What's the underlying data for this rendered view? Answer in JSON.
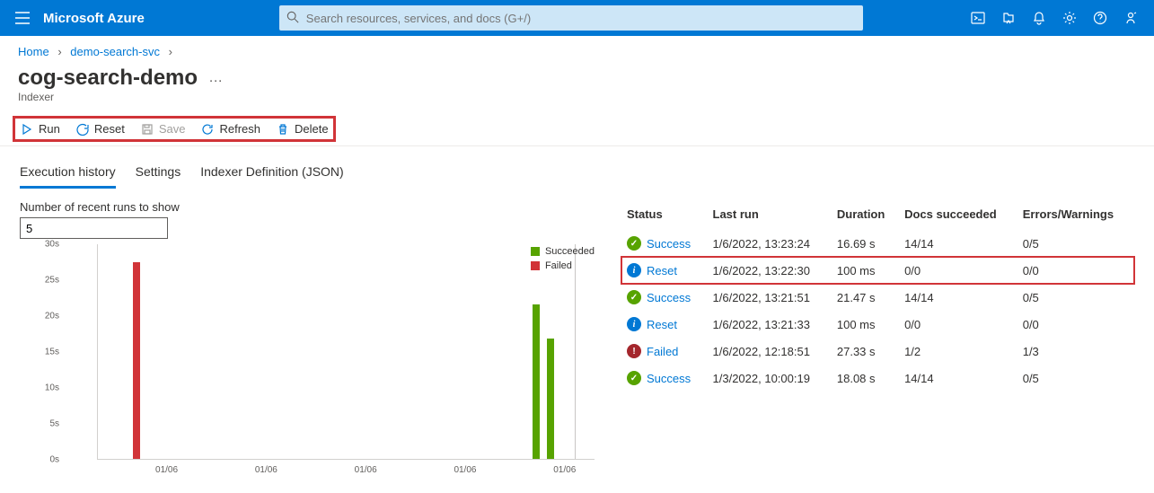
{
  "brand": "Microsoft Azure",
  "search": {
    "placeholder": "Search resources, services, and docs (G+/)"
  },
  "breadcrumb": {
    "home": "Home",
    "parent": "demo-search-svc"
  },
  "page": {
    "title": "cog-search-demo",
    "subtitle": "Indexer"
  },
  "toolbar": {
    "run": "Run",
    "reset": "Reset",
    "save": "Save",
    "refresh": "Refresh",
    "delete": "Delete"
  },
  "tabs": {
    "t0": "Execution history",
    "t1": "Settings",
    "t2": "Indexer Definition (JSON)"
  },
  "field": {
    "label": "Number of recent runs to show",
    "value": "5"
  },
  "legend": {
    "succeeded": "Succeeded",
    "failed": "Failed"
  },
  "chart_data": {
    "type": "bar",
    "ylabel": "",
    "ylim": [
      0,
      30
    ],
    "y_ticks": [
      "0s",
      "5s",
      "10s",
      "15s",
      "20s",
      "25s",
      "30s"
    ],
    "x_ticks": [
      "01/06",
      "01/06",
      "01/06",
      "01/06",
      "01/06"
    ],
    "series": [
      {
        "name": "Failed",
        "values": [
          27.33
        ],
        "color": "#d13438",
        "positions": [
          0.07
        ]
      },
      {
        "name": "Succeeded",
        "values": [
          21.47,
          16.69
        ],
        "color": "#57a300",
        "positions": [
          0.875,
          0.905
        ]
      }
    ]
  },
  "table": {
    "headers": {
      "status": "Status",
      "last_run": "Last run",
      "duration": "Duration",
      "docs": "Docs succeeded",
      "errs": "Errors/Warnings"
    },
    "rows": [
      {
        "status": "Success",
        "icon": "success",
        "last_run": "1/6/2022, 13:23:24",
        "duration": "16.69 s",
        "docs": "14/14",
        "errs": "0/5"
      },
      {
        "status": "Reset",
        "icon": "info",
        "last_run": "1/6/2022, 13:22:30",
        "duration": "100 ms",
        "docs": "0/0",
        "errs": "0/0",
        "highlight": true
      },
      {
        "status": "Success",
        "icon": "success",
        "last_run": "1/6/2022, 13:21:51",
        "duration": "21.47 s",
        "docs": "14/14",
        "errs": "0/5"
      },
      {
        "status": "Reset",
        "icon": "info",
        "last_run": "1/6/2022, 13:21:33",
        "duration": "100 ms",
        "docs": "0/0",
        "errs": "0/0"
      },
      {
        "status": "Failed",
        "icon": "fail",
        "last_run": "1/6/2022, 12:18:51",
        "duration": "27.33 s",
        "docs": "1/2",
        "errs": "1/3"
      },
      {
        "status": "Success",
        "icon": "success",
        "last_run": "1/3/2022, 10:00:19",
        "duration": "18.08 s",
        "docs": "14/14",
        "errs": "0/5"
      }
    ]
  }
}
